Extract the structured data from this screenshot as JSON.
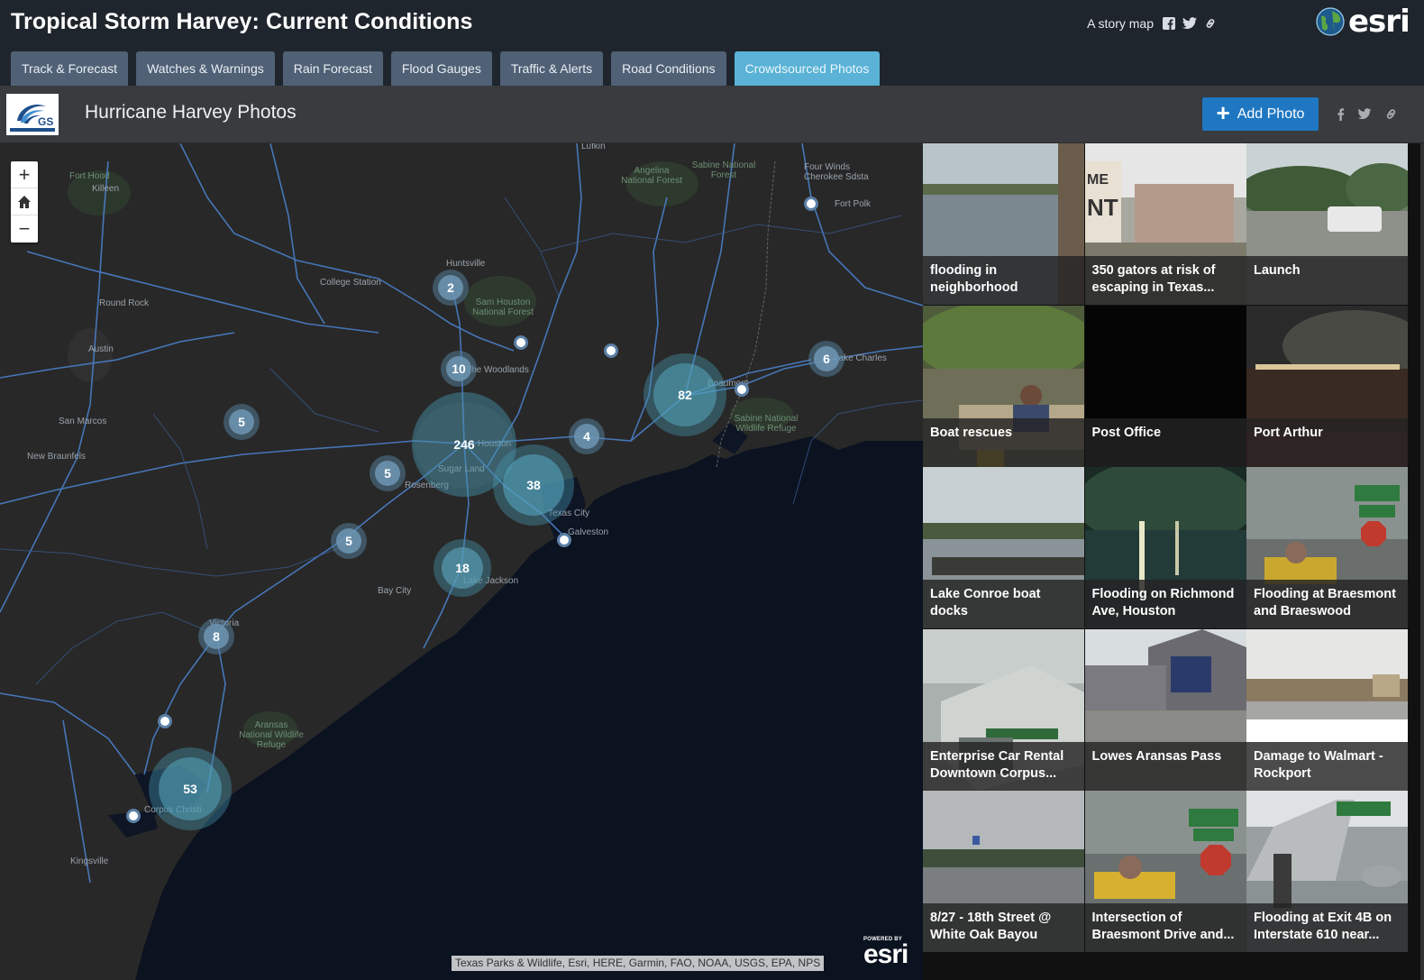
{
  "header": {
    "title": "Tropical Storm Harvey: Current Conditions",
    "story_map_label": "A story map",
    "brand": "esri"
  },
  "tabs": [
    {
      "label": "Track & Forecast",
      "active": false
    },
    {
      "label": "Watches & Warnings",
      "active": false
    },
    {
      "label": "Rain Forecast",
      "active": false
    },
    {
      "label": "Flood Gauges",
      "active": false
    },
    {
      "label": "Traffic & Alerts",
      "active": false
    },
    {
      "label": "Road Conditions",
      "active": false
    },
    {
      "label": "Crowdsourced Photos",
      "active": true
    }
  ],
  "subheader": {
    "title": "Hurricane Harvey Photos",
    "add_photo_label": "Add Photo"
  },
  "map": {
    "zoom_in": "+",
    "zoom_out": "−",
    "clusters": [
      "246",
      "82",
      "53",
      "38",
      "18",
      "10",
      "8",
      "6",
      "5",
      "5",
      "5",
      "4",
      "2"
    ],
    "places": [
      "Lufkin",
      "Fort Hood",
      "Killeen",
      "Angelina National Forest",
      "Sabine National Forest",
      "Four Winds Cherokee Sdsta",
      "Fort Polk",
      "Huntsville",
      "College Station",
      "Round Rock",
      "Sam Houston National Forest",
      "Austin",
      "The Woodlands",
      "Beaumont",
      "Lake Charles",
      "San Marcos",
      "Houston",
      "Sabine National Wildlife Refuge",
      "New Braunfels",
      "Sugar Land",
      "Rosenberg",
      "Texas City",
      "Galveston",
      "Lake Jackson",
      "Bay City",
      "Victoria",
      "Aransas National Wildlife Refuge",
      "Corpus Christi",
      "Kingsville"
    ],
    "attribution": "Texas Parks & Wildlife, Esri, HERE, Garmin, FAO, NOAA, USGS, EPA, NPS",
    "powered_by": "POWERED BY",
    "powered_brand": "esri"
  },
  "gallery": [
    {
      "caption": "flooding in neighborhood",
      "scene": "flood-field"
    },
    {
      "caption": "350 gators at risk of escaping in Texas...",
      "scene": "sign-water"
    },
    {
      "caption": "Launch",
      "scene": "truck-flood"
    },
    {
      "caption": "Boat rescues",
      "scene": "boat"
    },
    {
      "caption": "Post Office",
      "scene": "dark"
    },
    {
      "caption": "Port Arthur",
      "scene": "night-street"
    },
    {
      "caption": "Lake Conroe boat docks",
      "scene": "lake"
    },
    {
      "caption": "Flooding on Richmond Ave, Houston",
      "scene": "night-flood"
    },
    {
      "caption": "Flooding at Braesmont and Braeswood",
      "scene": "kayak-sign"
    },
    {
      "caption": "Enterprise Car Rental Downtown Corpus...",
      "scene": "building"
    },
    {
      "caption": "Lowes Aransas Pass",
      "scene": "store"
    },
    {
      "caption": "Damage to Walmart - Rockport",
      "scene": "walmart"
    },
    {
      "caption": "8/27 - 18th Street @ White Oak Bayou",
      "scene": "street-water"
    },
    {
      "caption": "Intersection of Braesmont Drive and...",
      "scene": "kayak-stop"
    },
    {
      "caption": "Flooding at Exit 4B on Interstate 610 near...",
      "scene": "highway"
    }
  ],
  "colors": {
    "topbar": "#1f252c",
    "tab": "#506176",
    "tab_active": "#5ab2d6",
    "add_photo": "#1f77c2",
    "cluster": "#5a9fb8"
  }
}
